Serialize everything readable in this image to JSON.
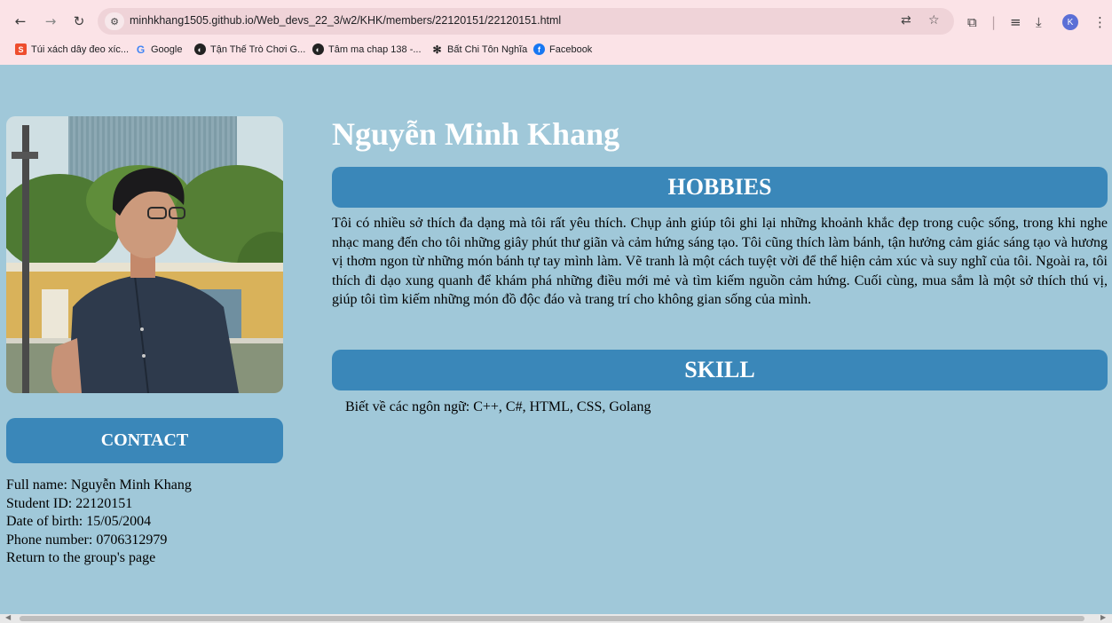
{
  "browser": {
    "url": "minhkhang1505.github.io/Web_devs_22_3/w2/KHK/members/22120151/22120151.html",
    "profile_initial": "K",
    "bookmarks": [
      {
        "label": "Túi xách dây đeo xíc...",
        "icon": "shopee-icon",
        "color": "#ee4d2d"
      },
      {
        "label": "Google",
        "icon": "google-icon",
        "color": "#4285f4"
      },
      {
        "label": "Tận Thế Trò Chơi G...",
        "icon": "globe-icon",
        "color": "#222222"
      },
      {
        "label": "Tâm ma chap 138 -...",
        "icon": "globe-icon",
        "color": "#222222"
      },
      {
        "label": "Bất Chi Tôn Nghĩa",
        "icon": "openai-icon",
        "color": "#222222"
      },
      {
        "label": "Facebook",
        "icon": "facebook-icon",
        "color": "#1877f2"
      }
    ]
  },
  "page": {
    "name": "Nguyễn Minh Khang",
    "hobbies_title": "HOBBIES",
    "hobbies_text": "Tôi có nhiều sở thích đa dạng mà tôi rất yêu thích. Chụp ảnh giúp tôi ghi lại những khoảnh khắc đẹp trong cuộc sống, trong khi nghe nhạc mang đến cho tôi những giây phút thư giãn và cảm hứng sáng tạo. Tôi cũng thích làm bánh, tận hưởng cảm giác sáng tạo và hương vị thơm ngon từ những món bánh tự tay mình làm. Vẽ tranh là một cách tuyệt vời để thể hiện cảm xúc và suy nghĩ của tôi. Ngoài ra, tôi thích đi dạo xung quanh để khám phá những điều mới mẻ và tìm kiếm nguồn cảm hứng. Cuối cùng, mua sắm là một sở thích thú vị, giúp tôi tìm kiếm những món đồ độc đáo và trang trí cho không gian sống của mình.",
    "skill_title": "SKILL",
    "skill_text": "Biết về các ngôn ngữ: C++, C#, HTML, CSS, Golang",
    "contact_title": "CONTACT",
    "contact": {
      "full_name": "Full name: Nguyễn Minh Khang",
      "student_id": "Student ID: 22120151",
      "dob": "Date of birth: 15/05/2004",
      "phone": "Phone number: 0706312979",
      "return_link": "Return to the group's page"
    }
  },
  "colors": {
    "page_bg": "#a0c8d9",
    "header_bg": "#3a87b9",
    "chrome_bg": "#fbe3e7"
  }
}
